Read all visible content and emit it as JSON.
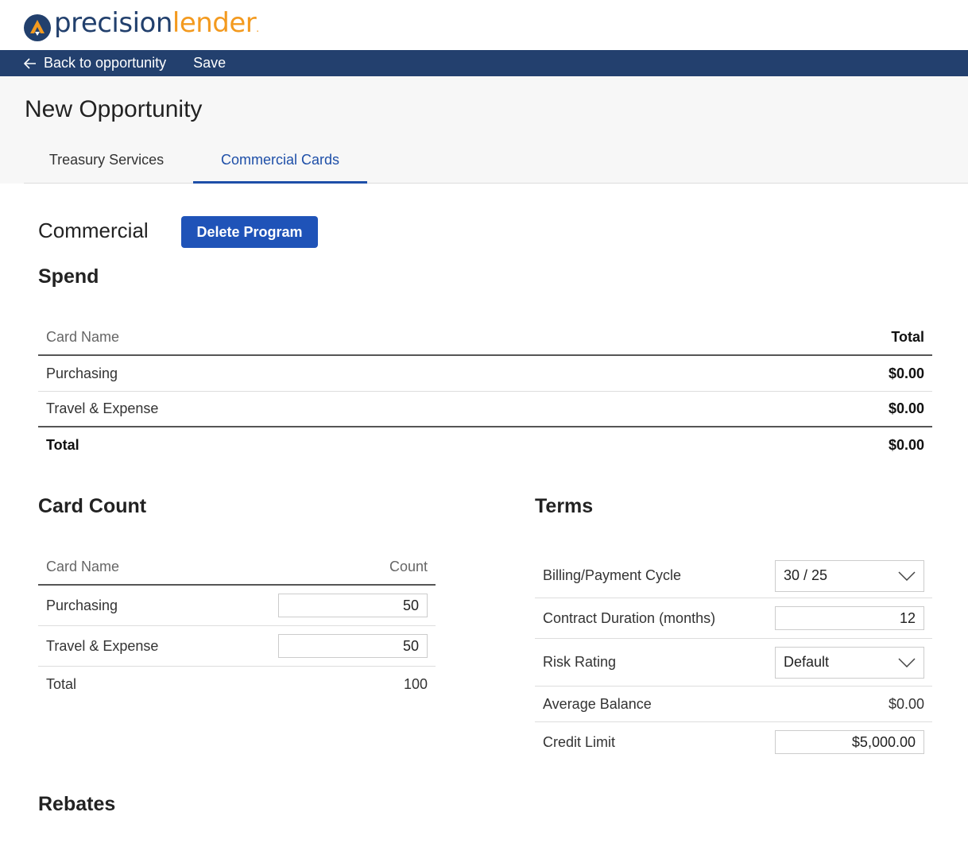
{
  "brand": {
    "logo_part1": "precision",
    "logo_part2": "lender",
    "logo_dot": "."
  },
  "colors": {
    "nav_bg": "#23406e",
    "accent": "#1e4fa8",
    "button_bg": "#1f53b8",
    "brand_orange": "#f39a1f",
    "brand_navy": "#22406d"
  },
  "nav": {
    "back_label": "Back to opportunity",
    "back_icon": "arrow-left-icon",
    "save_label": "Save"
  },
  "page": {
    "title": "New Opportunity"
  },
  "tabs": [
    {
      "label": "Treasury Services",
      "active": false
    },
    {
      "label": "Commercial Cards",
      "active": true
    }
  ],
  "program": {
    "title": "Commercial",
    "delete_label": "Delete Program"
  },
  "spend": {
    "title": "Spend",
    "headers": {
      "name": "Card Name",
      "total": "Total"
    },
    "rows": [
      {
        "name": "Purchasing",
        "total": "$0.00"
      },
      {
        "name": "Travel & Expense",
        "total": "$0.00"
      }
    ],
    "footer": {
      "name": "Total",
      "total": "$0.00"
    }
  },
  "card_count": {
    "title": "Card Count",
    "headers": {
      "name": "Card Name",
      "count": "Count"
    },
    "rows": [
      {
        "name": "Purchasing",
        "count": "50"
      },
      {
        "name": "Travel & Expense",
        "count": "50"
      }
    ],
    "footer": {
      "name": "Total",
      "count": "100"
    }
  },
  "terms": {
    "title": "Terms",
    "billing_cycle": {
      "label": "Billing/Payment Cycle",
      "value": "30 / 25"
    },
    "contract_duration": {
      "label": "Contract Duration (months)",
      "value": "12"
    },
    "risk_rating": {
      "label": "Risk Rating",
      "value": "Default"
    },
    "average_balance": {
      "label": "Average Balance",
      "value": "$0.00"
    },
    "credit_limit": {
      "label": "Credit Limit",
      "value": "$5,000.00"
    }
  },
  "rebates": {
    "title": "Rebates"
  }
}
